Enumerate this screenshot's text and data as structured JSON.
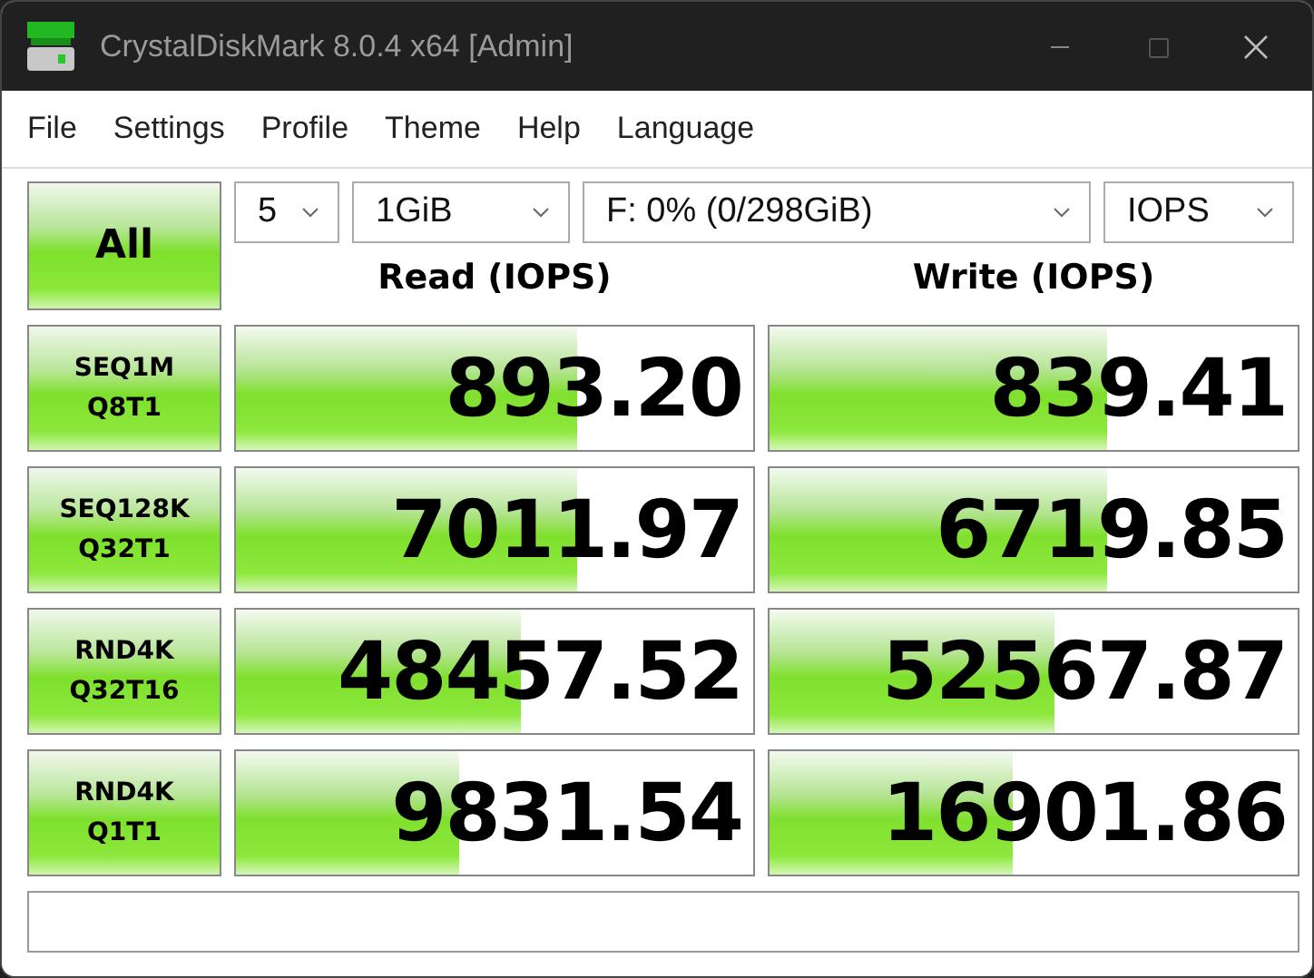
{
  "window": {
    "title": "CrystalDiskMark 8.0.4 x64 [Admin]"
  },
  "menu": [
    "File",
    "Settings",
    "Profile",
    "Theme",
    "Help",
    "Language"
  ],
  "all_button": "All",
  "selectors": [
    {
      "value": "5"
    },
    {
      "value": "1GiB"
    },
    {
      "value": "F: 0% (0/298GiB)"
    },
    {
      "value": "IOPS"
    }
  ],
  "headers": [
    "Read (IOPS)",
    "Write (IOPS)"
  ],
  "tests": [
    {
      "label": [
        "SEQ1M",
        "Q8T1"
      ],
      "read": {
        "value": "893.20",
        "level": 0.66
      },
      "write": {
        "value": "839.41",
        "level": 0.64
      }
    },
    {
      "label": [
        "SEQ128K",
        "Q32T1"
      ],
      "read": {
        "value": "7011.97",
        "level": 0.66
      },
      "write": {
        "value": "6719.85",
        "level": 0.64
      }
    },
    {
      "label": [
        "RND4K",
        "Q32T16"
      ],
      "read": {
        "value": "48457.52",
        "level": 0.55
      },
      "write": {
        "value": "52567.87",
        "level": 0.54
      }
    },
    {
      "label": [
        "RND4K",
        "Q1T1"
      ],
      "read": {
        "value": "9831.54",
        "level": 0.43
      },
      "write": {
        "value": "16901.86",
        "level": 0.46
      }
    }
  ]
}
